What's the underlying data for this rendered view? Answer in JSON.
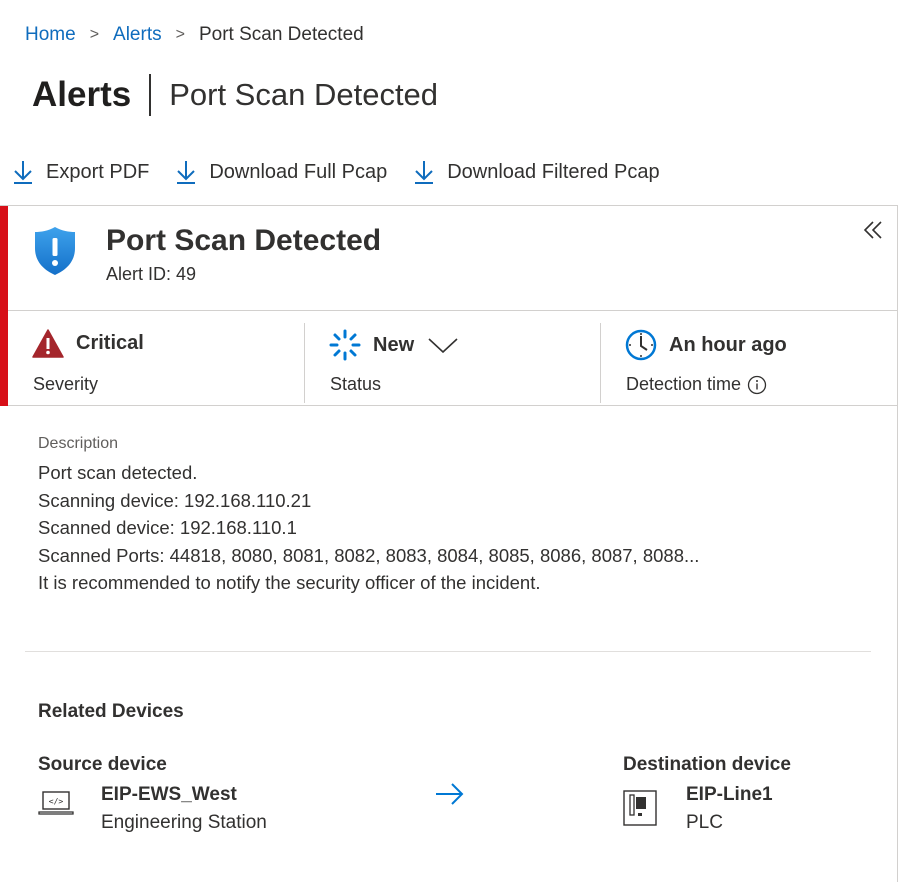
{
  "breadcrumb": {
    "home": "Home",
    "alerts": "Alerts",
    "current": "Port Scan Detected",
    "separator": ">"
  },
  "page": {
    "title": "Alerts",
    "subtitle": "Port Scan Detected"
  },
  "toolbar": {
    "export_pdf": "Export PDF",
    "download_full_pcap": "Download Full Pcap",
    "download_filtered_pcap": "Download Filtered Pcap",
    "icon": "download-icon"
  },
  "alert": {
    "title": "Port Scan Detected",
    "id_label": "Alert ID: 49",
    "icon": "shield-alert-icon",
    "accent_color": "#d70f18"
  },
  "stats": {
    "severity": {
      "value": "Critical",
      "label": "Severity",
      "icon": "warning-triangle-icon",
      "color": "#a4262c"
    },
    "status": {
      "value": "New",
      "label": "Status",
      "icon": "new-status-icon",
      "color": "#0078d4"
    },
    "detection": {
      "value": "An hour ago",
      "label": "Detection time",
      "icon": "clock-icon",
      "info_icon": "info-icon"
    }
  },
  "description": {
    "heading": "Description",
    "lines": [
      "Port scan detected.",
      "Scanning device: 192.168.110.21",
      "Scanned device: 192.168.110.1",
      "Scanned Ports: 44818, 8080, 8081, 8082, 8083, 8084, 8085, 8086, 8087, 8088...",
      "It is recommended to notify the security officer of the incident."
    ]
  },
  "related": {
    "title": "Related Devices",
    "source": {
      "label": "Source device",
      "name": "EIP-EWS_West",
      "type": "Engineering Station",
      "icon": "laptop-code-icon"
    },
    "destination": {
      "label": "Destination device",
      "name": "EIP-Line1",
      "type": "PLC",
      "icon": "plc-icon"
    },
    "arrow_icon": "arrow-right-icon"
  }
}
